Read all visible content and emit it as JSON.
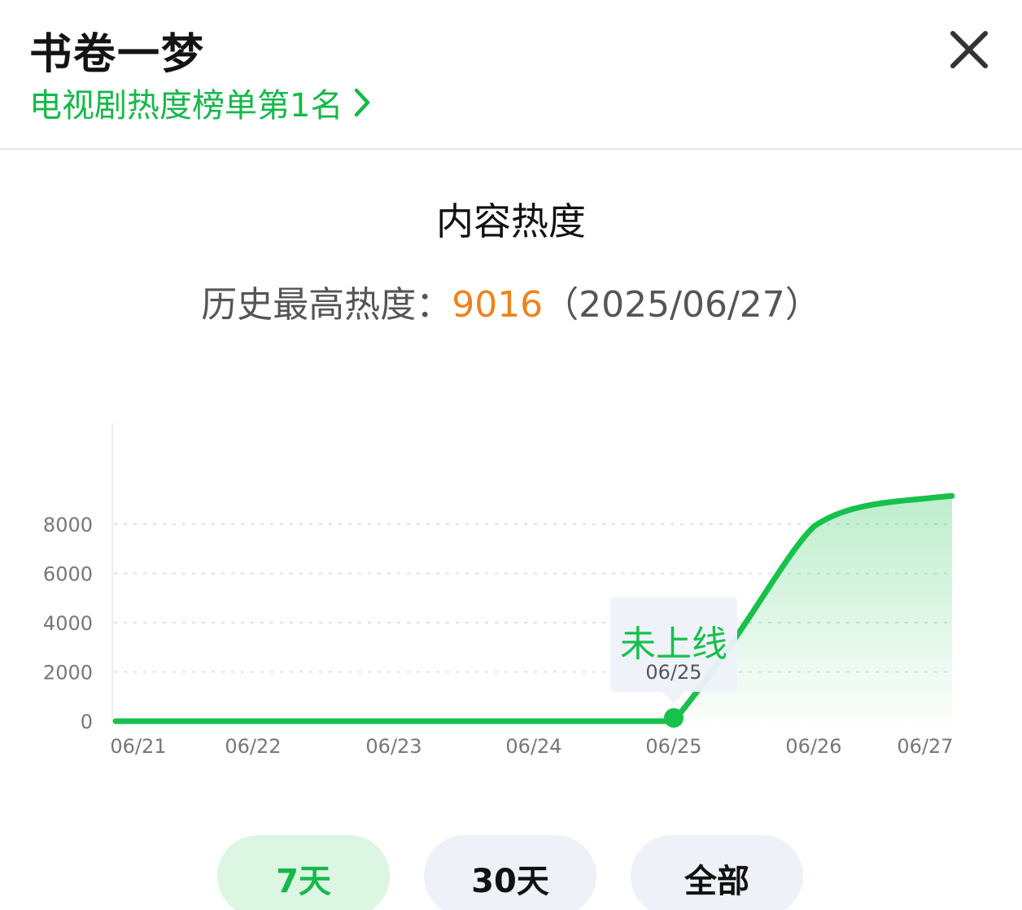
{
  "header": {
    "title": "书卷一梦",
    "rank_text": "电视剧热度榜单第1名"
  },
  "heat": {
    "title": "内容热度",
    "record_label": "历史最高热度：",
    "record_value": "9016",
    "record_date": "（2025/06/27）"
  },
  "chart_data": {
    "type": "area",
    "x": [
      "06/21",
      "06/22",
      "06/23",
      "06/24",
      "06/25",
      "06/26",
      "06/27"
    ],
    "values": [
      0,
      0,
      0,
      0,
      0,
      7900,
      9016
    ],
    "yticks": [
      0,
      2000,
      4000,
      6000,
      8000
    ],
    "ylim": [
      0,
      11000
    ],
    "grid": true,
    "line_color": "#16c14c",
    "tooltip": {
      "status": "未上线",
      "date": "06/25",
      "x": "06/25"
    }
  },
  "tabs": [
    {
      "label": "7天",
      "active": true
    },
    {
      "label": "30天",
      "active": false
    },
    {
      "label": "全部",
      "active": false
    }
  ],
  "colors": {
    "accent": "#16b84a",
    "highlight": "#f0821e"
  }
}
